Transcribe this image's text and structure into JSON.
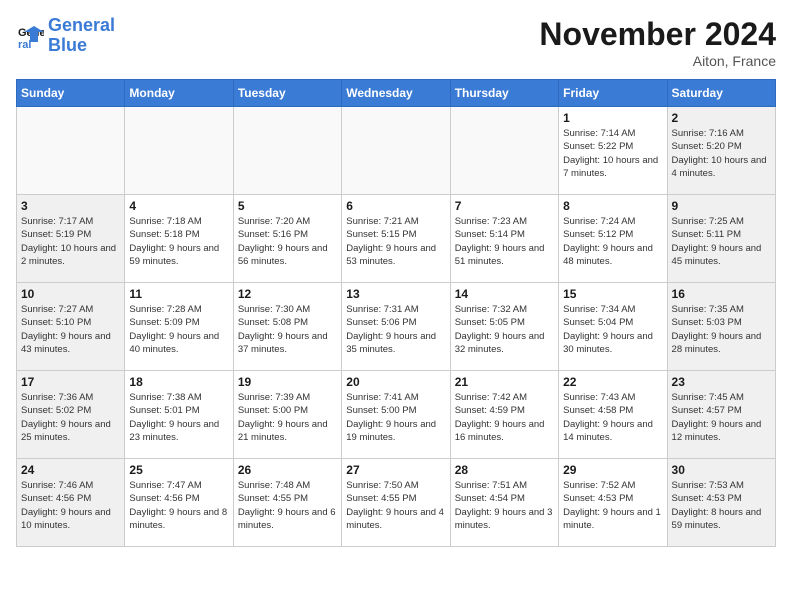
{
  "header": {
    "logo_line1": "General",
    "logo_line2": "Blue",
    "month": "November 2024",
    "location": "Aiton, France"
  },
  "weekdays": [
    "Sunday",
    "Monday",
    "Tuesday",
    "Wednesday",
    "Thursday",
    "Friday",
    "Saturday"
  ],
  "weeks": [
    [
      {
        "day": "",
        "info": ""
      },
      {
        "day": "",
        "info": ""
      },
      {
        "day": "",
        "info": ""
      },
      {
        "day": "",
        "info": ""
      },
      {
        "day": "",
        "info": ""
      },
      {
        "day": "1",
        "info": "Sunrise: 7:14 AM\nSunset: 5:22 PM\nDaylight: 10 hours and 7 minutes."
      },
      {
        "day": "2",
        "info": "Sunrise: 7:16 AM\nSunset: 5:20 PM\nDaylight: 10 hours and 4 minutes."
      }
    ],
    [
      {
        "day": "3",
        "info": "Sunrise: 7:17 AM\nSunset: 5:19 PM\nDaylight: 10 hours and 2 minutes."
      },
      {
        "day": "4",
        "info": "Sunrise: 7:18 AM\nSunset: 5:18 PM\nDaylight: 9 hours and 59 minutes."
      },
      {
        "day": "5",
        "info": "Sunrise: 7:20 AM\nSunset: 5:16 PM\nDaylight: 9 hours and 56 minutes."
      },
      {
        "day": "6",
        "info": "Sunrise: 7:21 AM\nSunset: 5:15 PM\nDaylight: 9 hours and 53 minutes."
      },
      {
        "day": "7",
        "info": "Sunrise: 7:23 AM\nSunset: 5:14 PM\nDaylight: 9 hours and 51 minutes."
      },
      {
        "day": "8",
        "info": "Sunrise: 7:24 AM\nSunset: 5:12 PM\nDaylight: 9 hours and 48 minutes."
      },
      {
        "day": "9",
        "info": "Sunrise: 7:25 AM\nSunset: 5:11 PM\nDaylight: 9 hours and 45 minutes."
      }
    ],
    [
      {
        "day": "10",
        "info": "Sunrise: 7:27 AM\nSunset: 5:10 PM\nDaylight: 9 hours and 43 minutes."
      },
      {
        "day": "11",
        "info": "Sunrise: 7:28 AM\nSunset: 5:09 PM\nDaylight: 9 hours and 40 minutes."
      },
      {
        "day": "12",
        "info": "Sunrise: 7:30 AM\nSunset: 5:08 PM\nDaylight: 9 hours and 37 minutes."
      },
      {
        "day": "13",
        "info": "Sunrise: 7:31 AM\nSunset: 5:06 PM\nDaylight: 9 hours and 35 minutes."
      },
      {
        "day": "14",
        "info": "Sunrise: 7:32 AM\nSunset: 5:05 PM\nDaylight: 9 hours and 32 minutes."
      },
      {
        "day": "15",
        "info": "Sunrise: 7:34 AM\nSunset: 5:04 PM\nDaylight: 9 hours and 30 minutes."
      },
      {
        "day": "16",
        "info": "Sunrise: 7:35 AM\nSunset: 5:03 PM\nDaylight: 9 hours and 28 minutes."
      }
    ],
    [
      {
        "day": "17",
        "info": "Sunrise: 7:36 AM\nSunset: 5:02 PM\nDaylight: 9 hours and 25 minutes."
      },
      {
        "day": "18",
        "info": "Sunrise: 7:38 AM\nSunset: 5:01 PM\nDaylight: 9 hours and 23 minutes."
      },
      {
        "day": "19",
        "info": "Sunrise: 7:39 AM\nSunset: 5:00 PM\nDaylight: 9 hours and 21 minutes."
      },
      {
        "day": "20",
        "info": "Sunrise: 7:41 AM\nSunset: 5:00 PM\nDaylight: 9 hours and 19 minutes."
      },
      {
        "day": "21",
        "info": "Sunrise: 7:42 AM\nSunset: 4:59 PM\nDaylight: 9 hours and 16 minutes."
      },
      {
        "day": "22",
        "info": "Sunrise: 7:43 AM\nSunset: 4:58 PM\nDaylight: 9 hours and 14 minutes."
      },
      {
        "day": "23",
        "info": "Sunrise: 7:45 AM\nSunset: 4:57 PM\nDaylight: 9 hours and 12 minutes."
      }
    ],
    [
      {
        "day": "24",
        "info": "Sunrise: 7:46 AM\nSunset: 4:56 PM\nDaylight: 9 hours and 10 minutes."
      },
      {
        "day": "25",
        "info": "Sunrise: 7:47 AM\nSunset: 4:56 PM\nDaylight: 9 hours and 8 minutes."
      },
      {
        "day": "26",
        "info": "Sunrise: 7:48 AM\nSunset: 4:55 PM\nDaylight: 9 hours and 6 minutes."
      },
      {
        "day": "27",
        "info": "Sunrise: 7:50 AM\nSunset: 4:55 PM\nDaylight: 9 hours and 4 minutes."
      },
      {
        "day": "28",
        "info": "Sunrise: 7:51 AM\nSunset: 4:54 PM\nDaylight: 9 hours and 3 minutes."
      },
      {
        "day": "29",
        "info": "Sunrise: 7:52 AM\nSunset: 4:53 PM\nDaylight: 9 hours and 1 minute."
      },
      {
        "day": "30",
        "info": "Sunrise: 7:53 AM\nSunset: 4:53 PM\nDaylight: 8 hours and 59 minutes."
      }
    ]
  ]
}
